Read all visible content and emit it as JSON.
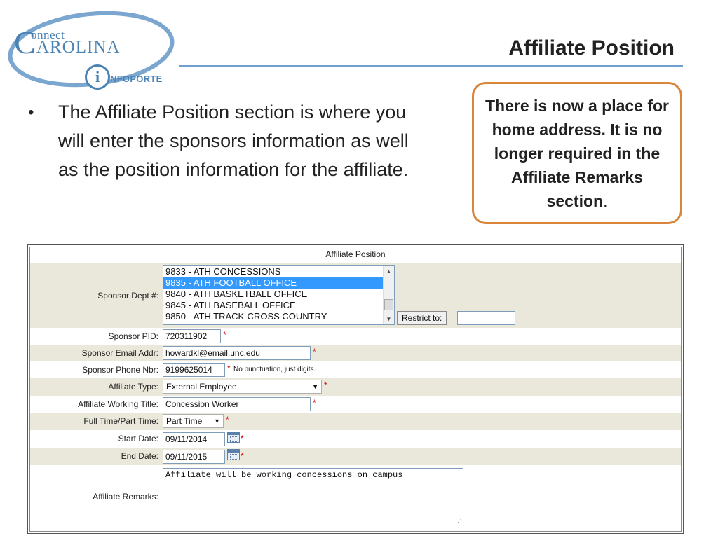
{
  "logo": {
    "connect": "onnect",
    "c_letter": "C",
    "carolina": "AROLINA",
    "i_letter": "i",
    "infoporte": "NFOPORTE"
  },
  "slide": {
    "title": "Affiliate Position",
    "bullet_symbol": "•",
    "bullet_text": "The Affiliate Position section is where you will enter the sponsors information as well as the position information for the affiliate.",
    "callout_text": "There is now a place for home address. It is no longer required in the Affiliate Remarks section",
    "callout_period": "."
  },
  "form": {
    "header": "Affiliate Position",
    "required_mark": "*",
    "sponsor_dept": {
      "label": "Sponsor Dept #:",
      "options": [
        "9833 - ATH CONCESSIONS",
        "9835 - ATH FOOTBALL OFFICE",
        "9840 - ATH BASKETBALL OFFICE",
        "9845 - ATH BASEBALL OFFICE",
        "9850 - ATH TRACK-CROSS COUNTRY"
      ],
      "selected_index": 1,
      "restrict_label": "Restrict to:",
      "restrict_value": ""
    },
    "sponsor_pid": {
      "label": "Sponsor PID:",
      "value": "720311902"
    },
    "sponsor_email": {
      "label": "Sponsor Email Addr:",
      "value": "howardkl@email.unc.edu"
    },
    "sponsor_phone": {
      "label": "Sponsor Phone Nbr:",
      "value": "9199625014",
      "hint": "No punctuation, just digits."
    },
    "affiliate_type": {
      "label": "Affiliate Type:",
      "value": "External Employee"
    },
    "working_title": {
      "label": "Affiliate Working Title:",
      "value": "Concession Worker"
    },
    "full_part_time": {
      "label": "Full Time/Part Time:",
      "value": "Part Time"
    },
    "start_date": {
      "label": "Start Date:",
      "value": "09/11/2014"
    },
    "end_date": {
      "label": "End Date:",
      "value": "09/11/2015"
    },
    "remarks": {
      "label": "Affiliate Remarks:",
      "value": "Affiliate will be working concessions on campus"
    }
  }
}
